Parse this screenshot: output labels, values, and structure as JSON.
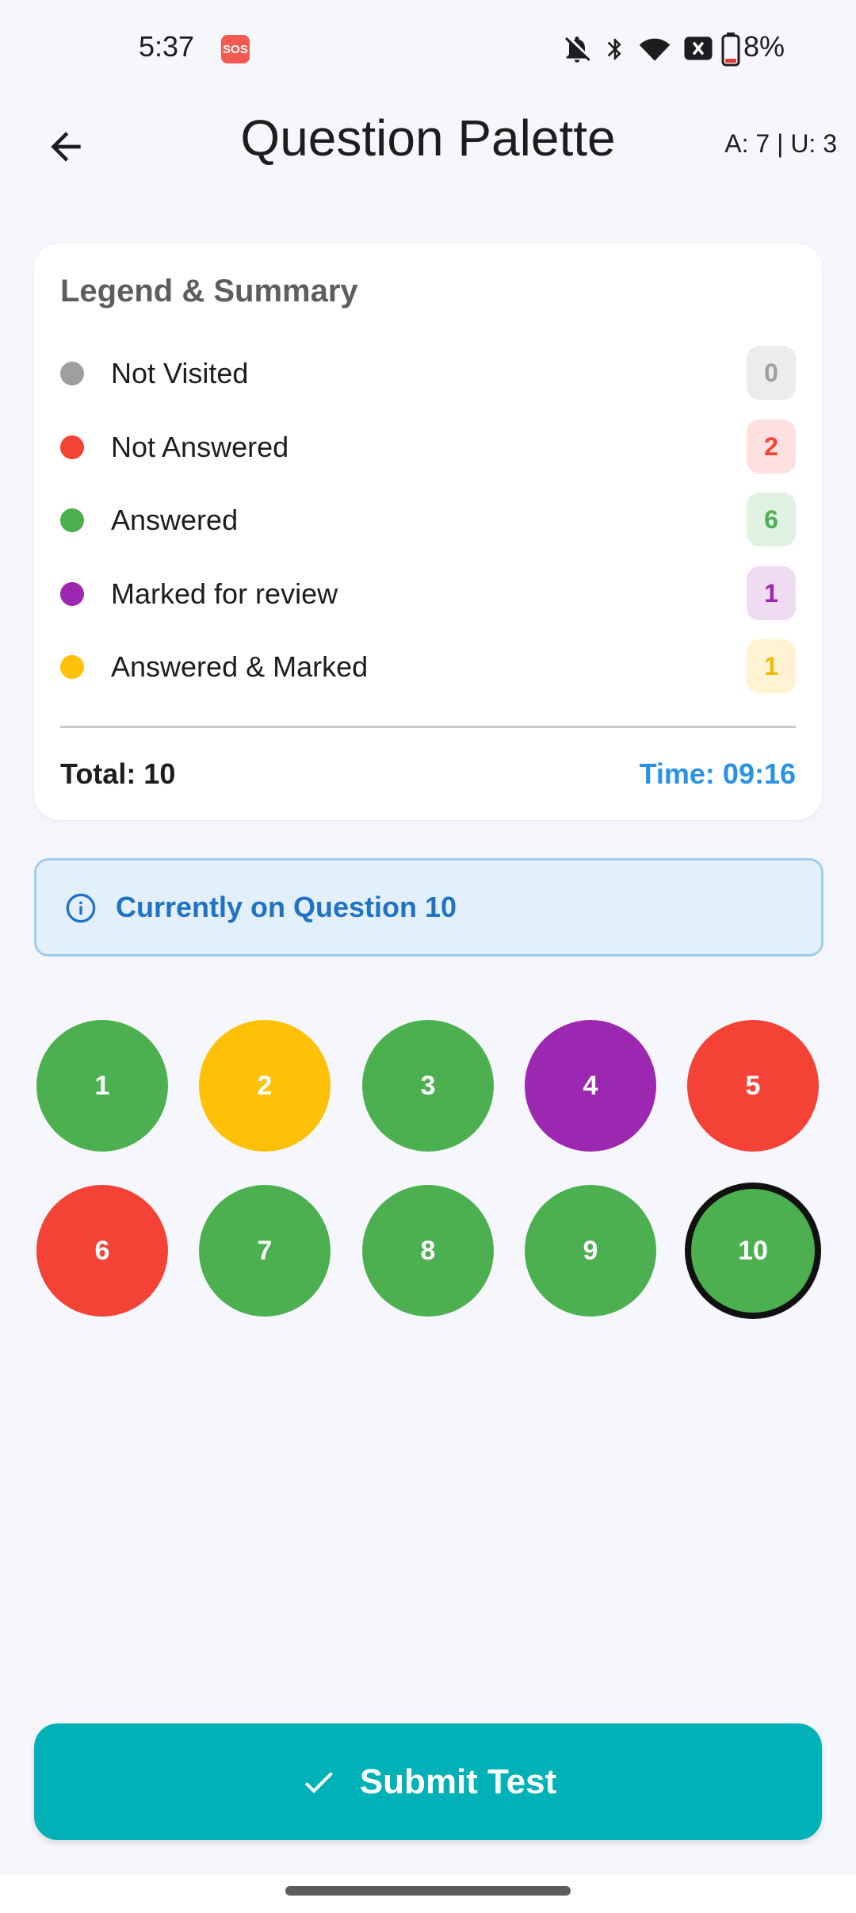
{
  "status_bar": {
    "time": "5:37",
    "sos_label": "SOS",
    "battery_percent": "8%",
    "icons": [
      "notifications-off-icon",
      "bluetooth-icon",
      "wifi-icon",
      "no-sim-icon",
      "battery-low-icon"
    ]
  },
  "header": {
    "title": "Question Palette",
    "counter": "A: 7 | U: 3",
    "back_icon": "arrow-left-icon"
  },
  "legend": {
    "title": "Legend & Summary",
    "items": [
      {
        "label": "Not Visited",
        "count": "0",
        "color": "#9e9e9e",
        "badge_bg": "#ececec",
        "badge_text": "#9e9e9e"
      },
      {
        "label": "Not Answered",
        "count": "2",
        "color": "#f44336",
        "badge_bg": "#fde0df",
        "badge_text": "#f44336"
      },
      {
        "label": "Answered",
        "count": "6",
        "color": "#4caf50",
        "badge_bg": "#e2f2e2",
        "badge_text": "#4caf50"
      },
      {
        "label": "Marked for review",
        "count": "1",
        "color": "#9c27b0",
        "badge_bg": "#efdcf3",
        "badge_text": "#9c27b0"
      },
      {
        "label": "Answered & Marked",
        "count": "1",
        "color": "#ffc107",
        "badge_bg": "#fff3d2",
        "badge_text": "#f5b800"
      }
    ],
    "total": "Total: 10",
    "time": "Time: 09:16"
  },
  "info_banner": {
    "icon": "info-icon",
    "text": "Currently on Question 10"
  },
  "questions": [
    {
      "number": "1",
      "status": "answered",
      "color": "#4caf50",
      "current": false
    },
    {
      "number": "2",
      "status": "answered-marked",
      "color": "#ffc107",
      "current": false
    },
    {
      "number": "3",
      "status": "answered",
      "color": "#4caf50",
      "current": false
    },
    {
      "number": "4",
      "status": "marked",
      "color": "#9c27b0",
      "current": false
    },
    {
      "number": "5",
      "status": "not-answered",
      "color": "#f44336",
      "current": false
    },
    {
      "number": "6",
      "status": "not-answered",
      "color": "#f44336",
      "current": false
    },
    {
      "number": "7",
      "status": "answered",
      "color": "#4caf50",
      "current": false
    },
    {
      "number": "8",
      "status": "answered",
      "color": "#4caf50",
      "current": false
    },
    {
      "number": "9",
      "status": "answered",
      "color": "#4caf50",
      "current": false
    },
    {
      "number": "10",
      "status": "answered",
      "color": "#4caf50",
      "current": true
    }
  ],
  "submit": {
    "label": "Submit Test",
    "icon": "check-icon",
    "color": "#00b2b7"
  }
}
